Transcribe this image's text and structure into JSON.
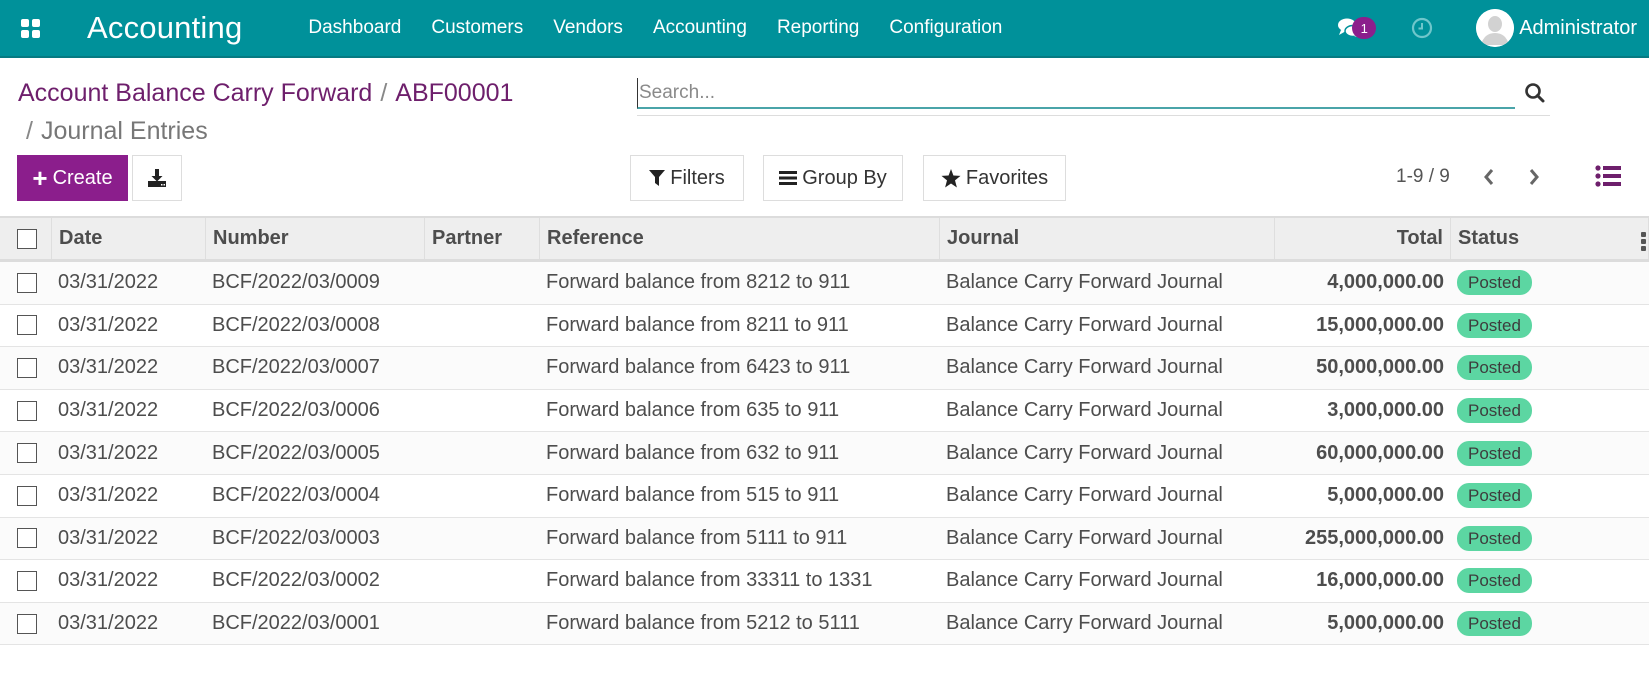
{
  "navbar": {
    "app_title": "Accounting",
    "menu": [
      "Dashboard",
      "Customers",
      "Vendors",
      "Accounting",
      "Reporting",
      "Configuration"
    ],
    "messages_count": "1",
    "user_name": "Administrator",
    "icons": {
      "apps": "grid-icon",
      "messages": "chat-bubbles-icon",
      "activities": "clock-icon",
      "avatar": "user-avatar-icon"
    }
  },
  "breadcrumb": {
    "items": [
      "Account Balance Carry Forward",
      "ABF00001"
    ],
    "separator": "/",
    "current": "Journal Entries"
  },
  "search": {
    "placeholder": "Search...",
    "value": ""
  },
  "toolbar": {
    "create_label": "Create",
    "filters_label": "Filters",
    "group_by_label": "Group By",
    "favorites_label": "Favorites"
  },
  "pager": {
    "value": "1-9 / 9"
  },
  "colors": {
    "navbar": "#00919a",
    "primary": "#8b1e8c",
    "link": "#6e1f6c",
    "posted_badge": "#5cd6a2"
  },
  "table": {
    "columns": [
      "Date",
      "Number",
      "Partner",
      "Reference",
      "Journal",
      "Total",
      "Status"
    ],
    "rows": [
      {
        "date": "03/31/2022",
        "number": "BCF/2022/03/0009",
        "partner": "",
        "reference": "Forward balance from 8212 to 911",
        "journal": "Balance Carry Forward Journal",
        "total": "4,000,000.00",
        "status": "Posted"
      },
      {
        "date": "03/31/2022",
        "number": "BCF/2022/03/0008",
        "partner": "",
        "reference": "Forward balance from 8211 to 911",
        "journal": "Balance Carry Forward Journal",
        "total": "15,000,000.00",
        "status": "Posted"
      },
      {
        "date": "03/31/2022",
        "number": "BCF/2022/03/0007",
        "partner": "",
        "reference": "Forward balance from 6423 to 911",
        "journal": "Balance Carry Forward Journal",
        "total": "50,000,000.00",
        "status": "Posted"
      },
      {
        "date": "03/31/2022",
        "number": "BCF/2022/03/0006",
        "partner": "",
        "reference": "Forward balance from 635 to 911",
        "journal": "Balance Carry Forward Journal",
        "total": "3,000,000.00",
        "status": "Posted"
      },
      {
        "date": "03/31/2022",
        "number": "BCF/2022/03/0005",
        "partner": "",
        "reference": "Forward balance from 632 to 911",
        "journal": "Balance Carry Forward Journal",
        "total": "60,000,000.00",
        "status": "Posted"
      },
      {
        "date": "03/31/2022",
        "number": "BCF/2022/03/0004",
        "partner": "",
        "reference": "Forward balance from 515 to 911",
        "journal": "Balance Carry Forward Journal",
        "total": "5,000,000.00",
        "status": "Posted"
      },
      {
        "date": "03/31/2022",
        "number": "BCF/2022/03/0003",
        "partner": "",
        "reference": "Forward balance from 5111 to 911",
        "journal": "Balance Carry Forward Journal",
        "total": "255,000,000.00",
        "status": "Posted"
      },
      {
        "date": "03/31/2022",
        "number": "BCF/2022/03/0002",
        "partner": "",
        "reference": "Forward balance from 33311 to 1331",
        "journal": "Balance Carry Forward Journal",
        "total": "16,000,000.00",
        "status": "Posted"
      },
      {
        "date": "03/31/2022",
        "number": "BCF/2022/03/0001",
        "partner": "",
        "reference": "Forward balance from 5212 to 5111",
        "journal": "Balance Carry Forward Journal",
        "total": "5,000,000.00",
        "status": "Posted"
      }
    ]
  }
}
